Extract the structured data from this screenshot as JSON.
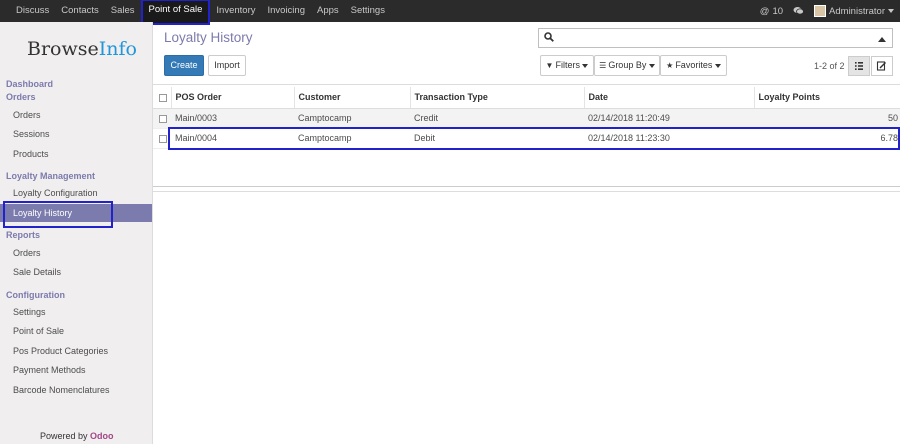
{
  "topnav": {
    "items": [
      "Discuss",
      "Contacts",
      "Sales",
      "Point of Sale",
      "Inventory",
      "Invoicing",
      "Apps",
      "Settings"
    ],
    "active_index": 3,
    "notification_count": "10",
    "user_name": "Administrator"
  },
  "sidebar": {
    "logo_part1": "Browse",
    "logo_part2": "Info",
    "sections": [
      {
        "title": "Dashboard"
      },
      {
        "title": "Orders"
      },
      {
        "title": "Loyalty Management"
      },
      {
        "title": "Reports"
      },
      {
        "title": "Configuration"
      }
    ],
    "items": [
      "Orders",
      "Sessions",
      "Products",
      "Loyalty Configuration",
      "Loyalty History",
      "Orders",
      "Sale Details",
      "Settings",
      "Point of Sale",
      "Pos Product Categories",
      "Payment Methods",
      "Barcode Nomenclatures"
    ],
    "active_item": "Loyalty History",
    "powered_by": "Powered by",
    "powered_brand": "Odoo"
  },
  "control_panel": {
    "title": "Loyalty History",
    "search_placeholder": "",
    "create_label": "Create",
    "import_label": "Import",
    "filters_label": "Filters",
    "groupby_label": "Group By",
    "favorites_label": "Favorites",
    "pager": "1-2 of 2"
  },
  "table": {
    "headers": [
      "POS Order",
      "Customer",
      "Transaction Type",
      "Date",
      "Loyalty Points"
    ],
    "rows": [
      {
        "order": "Main/0003",
        "customer": "Camptocamp",
        "type": "Credit",
        "date": "02/14/2018 11:20:49",
        "points": "50"
      },
      {
        "order": "Main/0004",
        "customer": "Camptocamp",
        "type": "Debit",
        "date": "02/14/2018 11:23:30",
        "points": "6.78"
      }
    ]
  },
  "colors": {
    "accent": "#7c7bad",
    "primary_button": "#337ab7",
    "highlight_box": "#2222cc",
    "brand_odoo": "#a24689"
  }
}
